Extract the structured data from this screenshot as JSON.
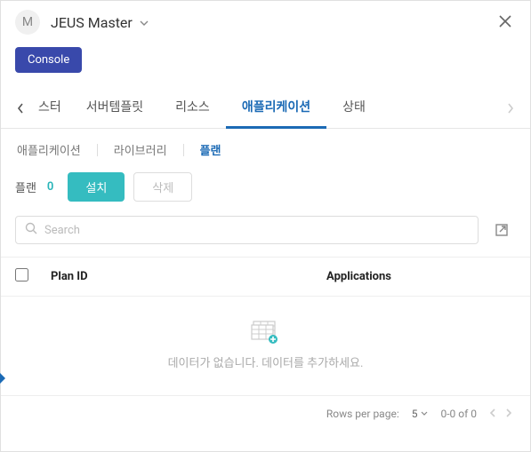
{
  "header": {
    "avatar_letter": "M",
    "title": "JEUS Master"
  },
  "console_button": "Console",
  "main_tabs": {
    "partial": "스터",
    "items": [
      "서버템플릿",
      "리소스",
      "애플리케이션",
      "상태"
    ],
    "active_index": 2
  },
  "sub_tabs": {
    "items": [
      "애플리케이션",
      "라이브러리",
      "플랜"
    ],
    "active_index": 2
  },
  "plan": {
    "label": "플랜",
    "count": "0",
    "install_btn": "설치",
    "delete_btn": "삭제"
  },
  "search": {
    "placeholder": "Search"
  },
  "table": {
    "columns": [
      "Plan ID",
      "Applications"
    ],
    "rows": []
  },
  "empty_state": {
    "message": "데이터가 없습니다. 데이터를 추가하세요."
  },
  "pagination": {
    "rows_per_page_label": "Rows per page:",
    "page_size": "5",
    "range": "0-0 of 0"
  }
}
